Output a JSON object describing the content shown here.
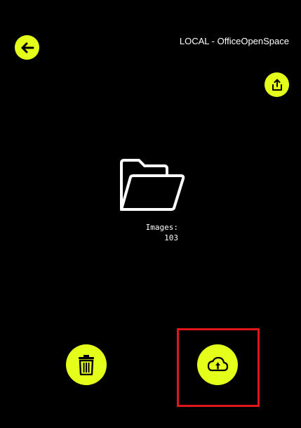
{
  "header": {
    "location": "LOCAL - OfficeOpenSpace"
  },
  "folder": {
    "images_label": "Images:",
    "images_count": "103"
  },
  "icons": {
    "back": "arrow-left-icon",
    "share": "share-export-icon",
    "folder": "open-folder-icon",
    "delete": "trash-icon",
    "upload": "cloud-upload-icon"
  },
  "colors": {
    "background": "#000000",
    "accent": "#e4ff1a",
    "highlight": "#e0161a",
    "text": "#ffffff"
  }
}
